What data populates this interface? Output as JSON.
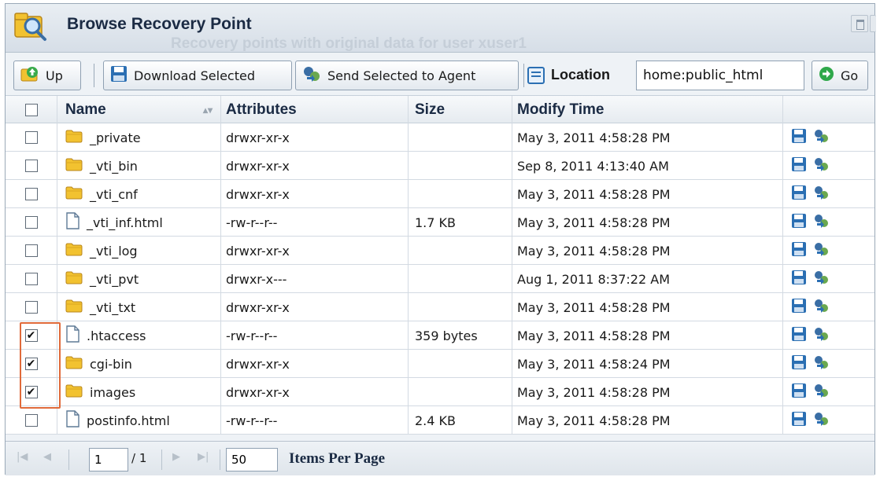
{
  "window": {
    "title": "Browse Recovery Point",
    "ghost_subtitle": "Recovery points with original data for user xuser1"
  },
  "toolbar": {
    "up_label": "Up",
    "download_label": "Download Selected",
    "send_label": "Send Selected to Agent",
    "location_label": "Location",
    "location_value": "home:public_html",
    "go_label": "Go"
  },
  "grid": {
    "columns": {
      "name": "Name",
      "attributes": "Attributes",
      "size": "Size",
      "modify_time": "Modify Time"
    },
    "rows": [
      {
        "name": "_private",
        "type": "folder",
        "attributes": "drwxr-xr-x",
        "size": "",
        "modified": "May 3, 2011 4:58:28 PM",
        "checked": false
      },
      {
        "name": "_vti_bin",
        "type": "folder",
        "attributes": "drwxr-xr-x",
        "size": "",
        "modified": "Sep 8, 2011 4:13:40 AM",
        "checked": false
      },
      {
        "name": "_vti_cnf",
        "type": "folder",
        "attributes": "drwxr-xr-x",
        "size": "",
        "modified": "May 3, 2011 4:58:28 PM",
        "checked": false
      },
      {
        "name": "_vti_inf.html",
        "type": "file",
        "attributes": "-rw-r--r--",
        "size": "1.7 KB",
        "modified": "May 3, 2011 4:58:28 PM",
        "checked": false
      },
      {
        "name": "_vti_log",
        "type": "folder",
        "attributes": "drwxr-xr-x",
        "size": "",
        "modified": "May 3, 2011 4:58:28 PM",
        "checked": false
      },
      {
        "name": "_vti_pvt",
        "type": "folder",
        "attributes": "drwxr-x---",
        "size": "",
        "modified": "Aug 1, 2011 8:37:22 AM",
        "checked": false
      },
      {
        "name": "_vti_txt",
        "type": "folder",
        "attributes": "drwxr-xr-x",
        "size": "",
        "modified": "May 3, 2011 4:58:28 PM",
        "checked": false
      },
      {
        "name": ".htaccess",
        "type": "file",
        "attributes": "-rw-r--r--",
        "size": "359 bytes",
        "modified": "May 3, 2011 4:58:28 PM",
        "checked": true
      },
      {
        "name": "cgi-bin",
        "type": "folder",
        "attributes": "drwxr-xr-x",
        "size": "",
        "modified": "May 3, 2011 4:58:24 PM",
        "checked": true
      },
      {
        "name": "images",
        "type": "folder",
        "attributes": "drwxr-xr-x",
        "size": "",
        "modified": "May 3, 2011 4:58:28 PM",
        "checked": true
      },
      {
        "name": "postinfo.html",
        "type": "file",
        "attributes": "-rw-r--r--",
        "size": "2.4 KB",
        "modified": "May 3, 2011 4:58:28 PM",
        "checked": false
      }
    ]
  },
  "paging": {
    "current_page": "1",
    "of_pages": "/ 1",
    "items_per_page": "50",
    "items_per_page_label": "Items Per Page"
  },
  "colors": {
    "highlight": "#e06a3a",
    "folder": "#f2c230",
    "save_icon": "#2b6fb3",
    "go_icon": "#2fa84a"
  },
  "icons": {
    "up": "folder-up-icon",
    "download": "floppy-disk-icon",
    "send": "agent-transfer-icon",
    "location": "location-icon",
    "go": "go-arrow-icon",
    "folder": "folder-icon",
    "file": "file-icon"
  }
}
